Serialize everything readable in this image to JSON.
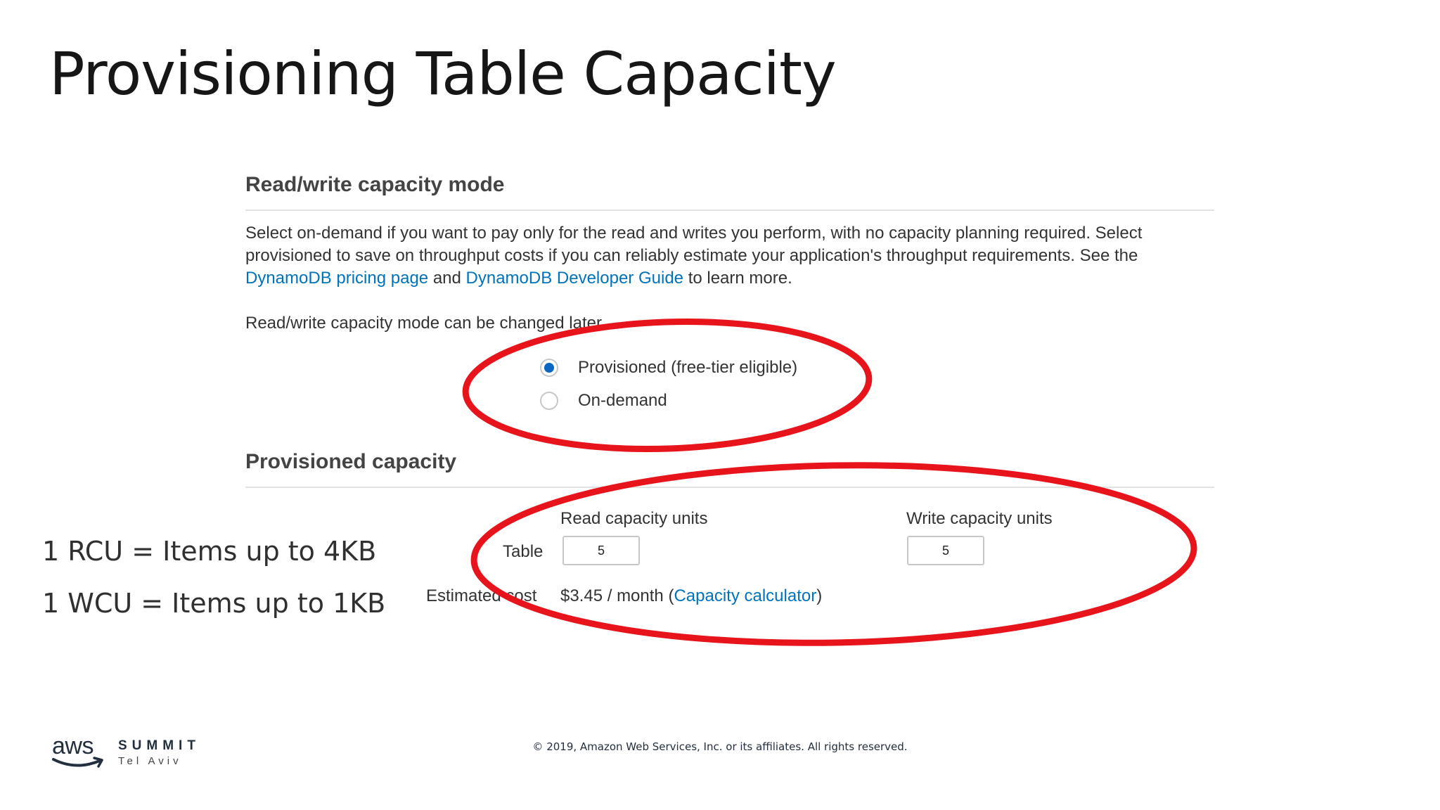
{
  "slide": {
    "title": "Provisioning Table Capacity"
  },
  "capacity_mode": {
    "heading": "Read/write capacity mode",
    "description_part1": "Select on-demand if you want to pay only for the read and writes you perform, with no capacity planning required. Select provisioned to save on throughput costs if you can reliably estimate your application's throughput requirements. See the",
    "pricing_link": "DynamoDB pricing page",
    "and_text": "and",
    "guide_link": "DynamoDB Developer Guide",
    "description_end": "to learn more.",
    "changed_note": "Read/write capacity mode can be changed later.",
    "options": [
      {
        "label": "Provisioned (free-tier eligible)",
        "selected": true
      },
      {
        "label": "On-demand",
        "selected": false
      }
    ]
  },
  "provisioned_capacity": {
    "heading": "Provisioned capacity",
    "read_label": "Read capacity units",
    "write_label": "Write capacity units",
    "row_label": "Table",
    "read_value": "5",
    "write_value": "5",
    "cost_label": "Estimated cost",
    "cost_value": "$3.45 / month",
    "calc_open": "(",
    "calc_link": "Capacity calculator",
    "calc_close": ")"
  },
  "notes": {
    "rcu": "1 RCU = Items up to 4KB",
    "wcu": "1 WCU = Items up to 1KB"
  },
  "footer": {
    "logo_word": "aws",
    "event": "SUMMIT",
    "city": "Tel Aviv",
    "copyright": "© 2019, Amazon Web Services, Inc. or its affiliates. All rights reserved."
  },
  "colors": {
    "annotation_red": "#e8141b",
    "link_blue": "#0073bb",
    "radio_blue": "#0a66c2",
    "aws_smile": "#232f3e"
  }
}
